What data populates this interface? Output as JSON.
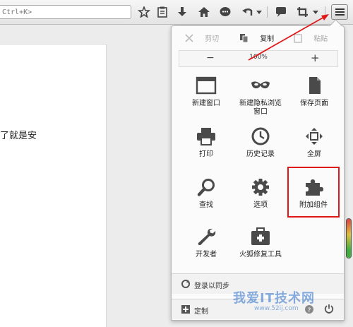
{
  "toolbar": {
    "search_hint": "Ctrl+K>",
    "icons": [
      "star-icon",
      "clipboard-icon",
      "download-icon",
      "home-icon",
      "chat-icon",
      "undo-icon",
      "dropdown-icon",
      "speech-bubble-icon",
      "crop-icon",
      "dropdown-icon",
      "menu-icon"
    ]
  },
  "content": {
    "fragment": "了就是安"
  },
  "menu": {
    "edit": {
      "cut": "剪切",
      "copy": "复制",
      "paste": "粘贴"
    },
    "zoom": {
      "minus": "−",
      "value": "100%",
      "plus": "+"
    },
    "items": {
      "new_window": "新建窗口",
      "new_private_line1": "新建隐私浏览",
      "new_private_line2": "窗口",
      "save_page": "保存页面",
      "print": "打印",
      "history": "历史记录",
      "fullscreen": "全屏",
      "find": "查找",
      "options": "选项",
      "addons": "附加组件",
      "developer": "开发者",
      "repair": "火狐修复工具"
    },
    "sync_label": "登录以同步",
    "customize_label": "定制"
  },
  "watermark": {
    "main": "我爱IT技术网",
    "sub": "www.52ij.com"
  },
  "colors": {
    "annotation": "#e01818",
    "icon": "#4a4a4a"
  }
}
